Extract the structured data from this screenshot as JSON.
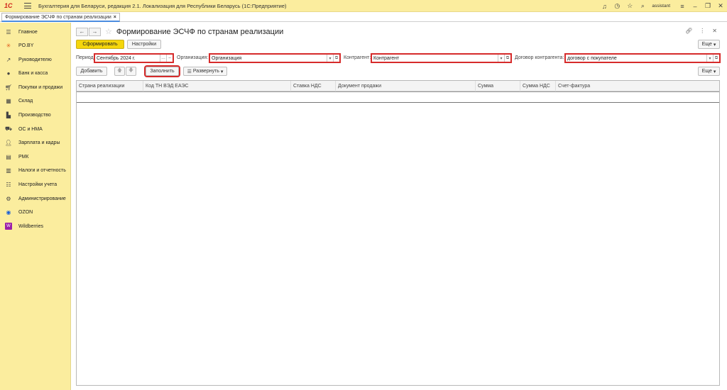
{
  "window": {
    "logo": "1С",
    "title": "Бухгалтерия для Беларуси, редакция 2.1. Локализация для Республики Беларусь  (1С:Предприятие)",
    "user": "assistant",
    "icons": [
      "bell-icon",
      "history-icon",
      "star-icon",
      "menu-icon",
      "minimize-icon",
      "restore-icon",
      "close-icon"
    ]
  },
  "tabs": [
    {
      "label": "Формирование ЭСЧФ по странам реализации",
      "close": "×"
    }
  ],
  "sidebar": {
    "items": [
      {
        "label": "Главное",
        "icon": "menu-lines-icon"
      },
      {
        "label": "PO.BY",
        "icon": "asterisk-icon"
      },
      {
        "label": "Руководителю",
        "icon": "trend-icon"
      },
      {
        "label": "Банк и касса",
        "icon": "coin-icon"
      },
      {
        "label": "Покупки и продажи",
        "icon": "cart-icon"
      },
      {
        "label": "Склад",
        "icon": "warehouse-icon"
      },
      {
        "label": "Производство",
        "icon": "factory-icon"
      },
      {
        "label": "ОС и НМА",
        "icon": "truck-icon"
      },
      {
        "label": "Зарплата и кадры",
        "icon": "person-icon"
      },
      {
        "label": "РМК",
        "icon": "register-icon"
      },
      {
        "label": "Налоги и отчетность",
        "icon": "chart-icon"
      },
      {
        "label": "Настройки учета",
        "icon": "settings-list-icon"
      },
      {
        "label": "Администрирование",
        "icon": "gear-icon"
      },
      {
        "label": "OZON",
        "icon": "ozon-icon"
      },
      {
        "label": "Wildberries",
        "icon": "wildberries-icon"
      }
    ]
  },
  "form": {
    "title": "Формирование ЭСЧФ по странам реализации",
    "back": "←",
    "forward": "→",
    "generate_button": "Сформировать",
    "settings_button": "Настройки",
    "more_button": "Еще",
    "filters": {
      "period_label": "Период:",
      "period_value": "Сентябрь 2024 г.",
      "org_label": "Организация:",
      "org_value": "Организация",
      "counterparty_label": "Контрагент:",
      "counterparty_value": "Контрагент",
      "contract_label": "Договор контрагента:",
      "contract_value": "договор с покупателе"
    },
    "table_toolbar": {
      "add": "Добавить",
      "fill": "Заполнить",
      "expand": "Развернуть",
      "more": "Еще"
    },
    "columns": [
      "Страна реализации",
      "Код ТН ВЭД ЕАЭС",
      "Ставка НДС",
      "Документ продажи",
      "Сумма",
      "Сумма НДС",
      "Счет-фактура"
    ]
  },
  "colors": {
    "panel": "#fbed9e",
    "primary_button": "#f5d60b",
    "highlight": "#d62b2b",
    "tab_accent": "#4c8de0"
  }
}
